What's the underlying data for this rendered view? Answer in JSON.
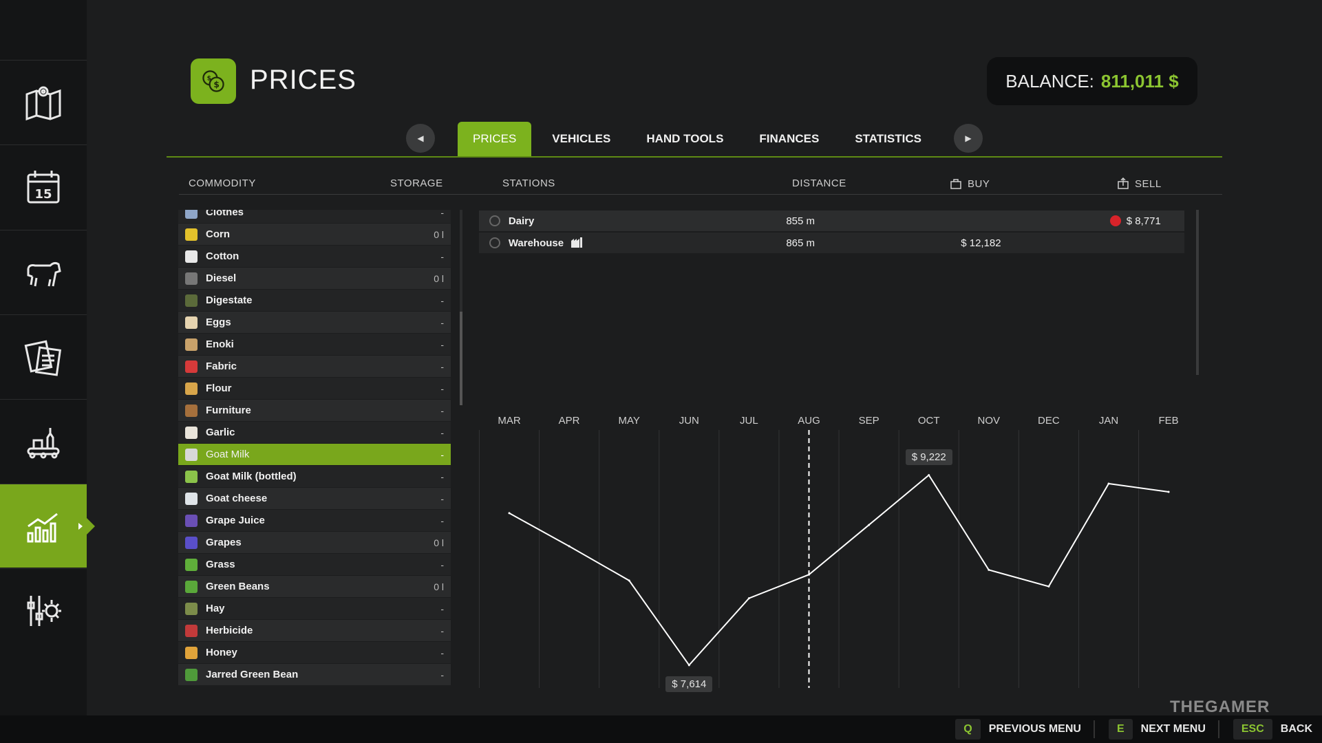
{
  "header": {
    "title": "PRICES",
    "balance_label": "BALANCE:",
    "balance_value": "811,011 $"
  },
  "tabs": [
    {
      "label": "PRICES",
      "active": true
    },
    {
      "label": "VEHICLES"
    },
    {
      "label": "HAND TOOLS"
    },
    {
      "label": "FINANCES"
    },
    {
      "label": "STATISTICS"
    }
  ],
  "columns": {
    "commodity": "COMMODITY",
    "storage": "STORAGE",
    "stations": "STATIONS",
    "distance": "DISTANCE",
    "buy": "BUY",
    "sell": "SELL"
  },
  "commodities": [
    {
      "name": "Clothes",
      "storage": "-",
      "icon": "clothes-icon",
      "color": "#8fa6c8"
    },
    {
      "name": "Corn",
      "storage": "0 l",
      "icon": "corn-icon",
      "color": "#e3c12b"
    },
    {
      "name": "Cotton",
      "storage": "-",
      "icon": "cotton-icon",
      "color": "#e8e8e8"
    },
    {
      "name": "Diesel",
      "storage": "0 l",
      "icon": "diesel-icon",
      "color": "#777777"
    },
    {
      "name": "Digestate",
      "storage": "-",
      "icon": "digestate-icon",
      "color": "#5b6a3a"
    },
    {
      "name": "Eggs",
      "storage": "-",
      "icon": "eggs-icon",
      "color": "#e6d4b0"
    },
    {
      "name": "Enoki",
      "storage": "-",
      "icon": "enoki-icon",
      "color": "#c9a26a"
    },
    {
      "name": "Fabric",
      "storage": "-",
      "icon": "fabric-icon",
      "color": "#d63a3a"
    },
    {
      "name": "Flour",
      "storage": "-",
      "icon": "flour-icon",
      "color": "#d8a54a"
    },
    {
      "name": "Furniture",
      "storage": "-",
      "icon": "furniture-icon",
      "color": "#a6703c"
    },
    {
      "name": "Garlic",
      "storage": "-",
      "icon": "garlic-icon",
      "color": "#e9e4da"
    },
    {
      "name": "Goat Milk",
      "storage": "-",
      "icon": "goat-milk-icon",
      "color": "#d8d8d8"
    },
    {
      "name": "Goat Milk (bottled)",
      "storage": "-",
      "icon": "goat-milk-bottled-icon",
      "color": "#8bc34a"
    },
    {
      "name": "Goat cheese",
      "storage": "-",
      "icon": "goat-cheese-icon",
      "color": "#dfe4e8"
    },
    {
      "name": "Grape Juice",
      "storage": "-",
      "icon": "grape-juice-icon",
      "color": "#6a4fb5"
    },
    {
      "name": "Grapes",
      "storage": "0 l",
      "icon": "grapes-icon",
      "color": "#5a4fc9"
    },
    {
      "name": "Grass",
      "storage": "-",
      "icon": "grass-icon",
      "color": "#5fae3a"
    },
    {
      "name": "Green Beans",
      "storage": "0 l",
      "icon": "green-beans-icon",
      "color": "#5aa83a"
    },
    {
      "name": "Hay",
      "storage": "-",
      "icon": "hay-icon",
      "color": "#7c8c4a"
    },
    {
      "name": "Herbicide",
      "storage": "-",
      "icon": "herbicide-icon",
      "color": "#c23a3a"
    },
    {
      "name": "Honey",
      "storage": "-",
      "icon": "honey-icon",
      "color": "#e0a33a"
    },
    {
      "name": "Jarred Green Bean",
      "storage": "-",
      "icon": "jarred-green-bean-icon",
      "color": "#4f9a3a"
    }
  ],
  "selected_commodity": "Goat Milk",
  "stations": [
    {
      "name": "Dairy",
      "distance": "855 m",
      "buy": "",
      "sell": "$ 8,771",
      "sell_icon": "price-down-icon"
    },
    {
      "name": "Warehouse",
      "distance": "865 m",
      "buy": "$ 12,182",
      "sell": "",
      "extra_icon": "warehouse-icon"
    }
  ],
  "chart_data": {
    "type": "line",
    "categories": [
      "MAR",
      "APR",
      "MAY",
      "JUN",
      "JUL",
      "AUG",
      "SEP",
      "OCT",
      "NOV",
      "DEC",
      "JAN",
      "FEB"
    ],
    "values": [
      8900,
      8620,
      8330,
      7614,
      8180,
      8380,
      8800,
      9222,
      8420,
      8280,
      9150,
      9080
    ],
    "current_month": "AUG",
    "annotations": [
      {
        "label": "$ 9,222",
        "month": "OCT",
        "type": "max"
      },
      {
        "label": "$ 7,614",
        "month": "JUN",
        "type": "min"
      }
    ],
    "ylim": [
      7450,
      9400
    ],
    "grid": true
  },
  "footer": [
    {
      "key": "Q",
      "label": "PREVIOUS MENU"
    },
    {
      "key": "E",
      "label": "NEXT MENU"
    },
    {
      "key": "ESC",
      "label": "BACK"
    }
  ],
  "watermark": "THEGAMER",
  "colors": {
    "accent": "#79a71c",
    "balance": "#8cc531"
  }
}
